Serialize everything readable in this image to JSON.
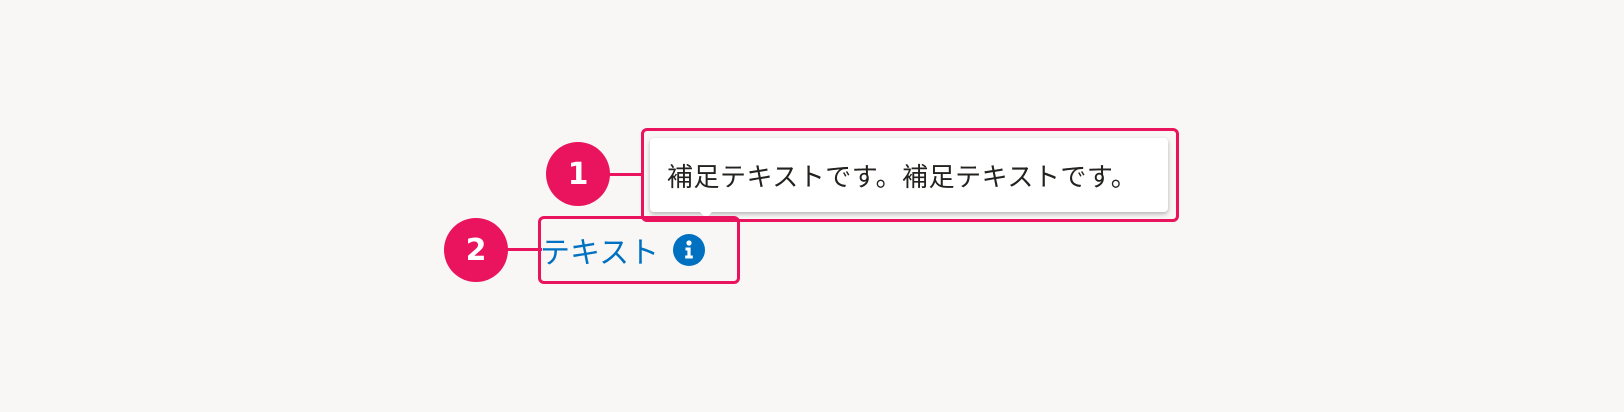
{
  "colors": {
    "background": "#f8f7f6",
    "annotation": "#ea135d",
    "link": "#0071c1",
    "tooltip_text": "#23221f",
    "tooltip_bg": "#ffffff"
  },
  "annotations": [
    {
      "number": "1"
    },
    {
      "number": "2"
    }
  ],
  "tooltip": {
    "text": "補足テキストです。補足テキストです。"
  },
  "trigger": {
    "label": "テキスト",
    "icon": "info-icon"
  }
}
